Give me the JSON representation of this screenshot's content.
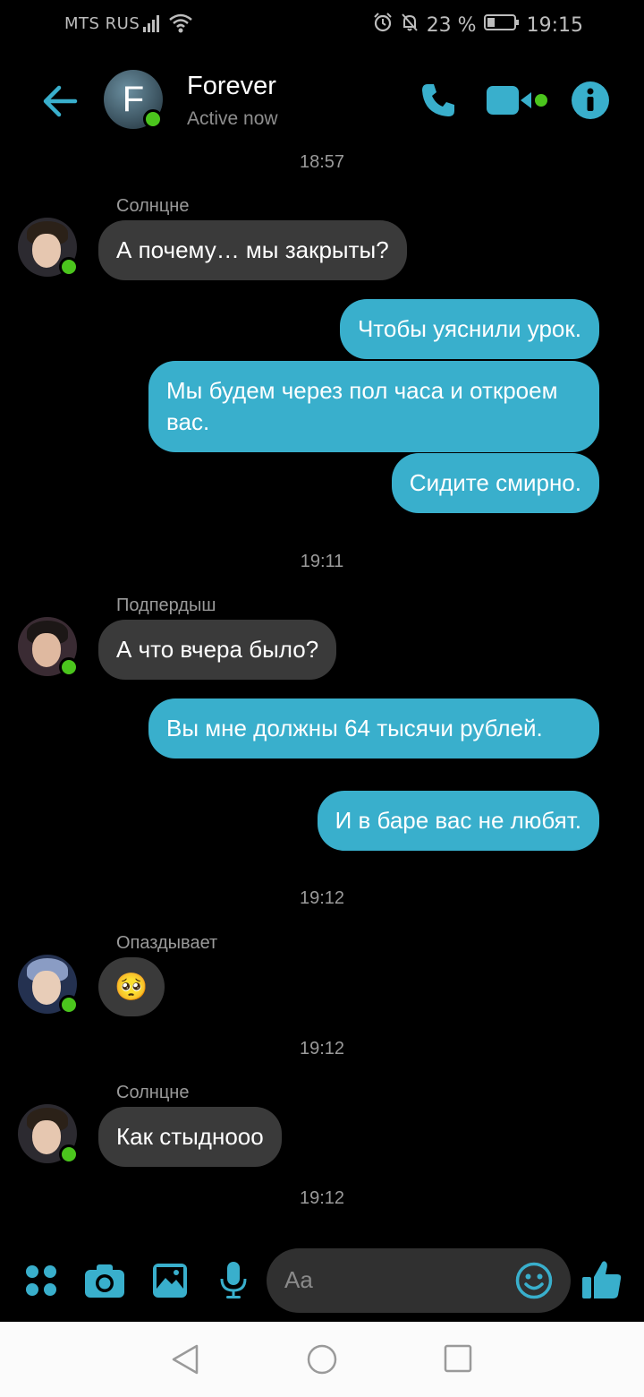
{
  "status_bar": {
    "carrier": "MTS RUS",
    "battery": "23 %",
    "time": "19:15"
  },
  "header": {
    "avatar_letter": "F",
    "title": "Forever",
    "status": "Active now",
    "accent_color": "#39afcc",
    "online_color": "#4bc51d"
  },
  "messages": {
    "sep1": "18:57",
    "group1": {
      "sender": "Солнцне",
      "text": "А почему… мы закрыты?"
    },
    "out1": [
      "Чтобы уяснили урок.",
      "Мы будем через пол часа и откроем вас.",
      "Сидите смирно."
    ],
    "sep2": "19:11",
    "group2": {
      "sender": "Подпердыш",
      "text": "А что вчера было?"
    },
    "out2": [
      "Вы мне должны 64 тысячи рублей.",
      "И в баре вас не любят."
    ],
    "sep3": "19:12",
    "group3": {
      "sender": "Опаздывает",
      "emoji": "🥺"
    },
    "sep4": "19:12",
    "group4": {
      "sender": "Солнцне",
      "text": "Как стыднооо"
    },
    "sep5": "19:12"
  },
  "composer": {
    "placeholder": "Aa"
  },
  "icons": {
    "back": "arrow-left-icon",
    "call": "phone-icon",
    "video": "video-camera-icon",
    "info": "info-icon",
    "more": "four-dots-icon",
    "camera": "camera-icon",
    "gallery": "image-icon",
    "mic": "microphone-icon",
    "emoji": "smiley-icon",
    "like": "thumbs-up-icon"
  }
}
